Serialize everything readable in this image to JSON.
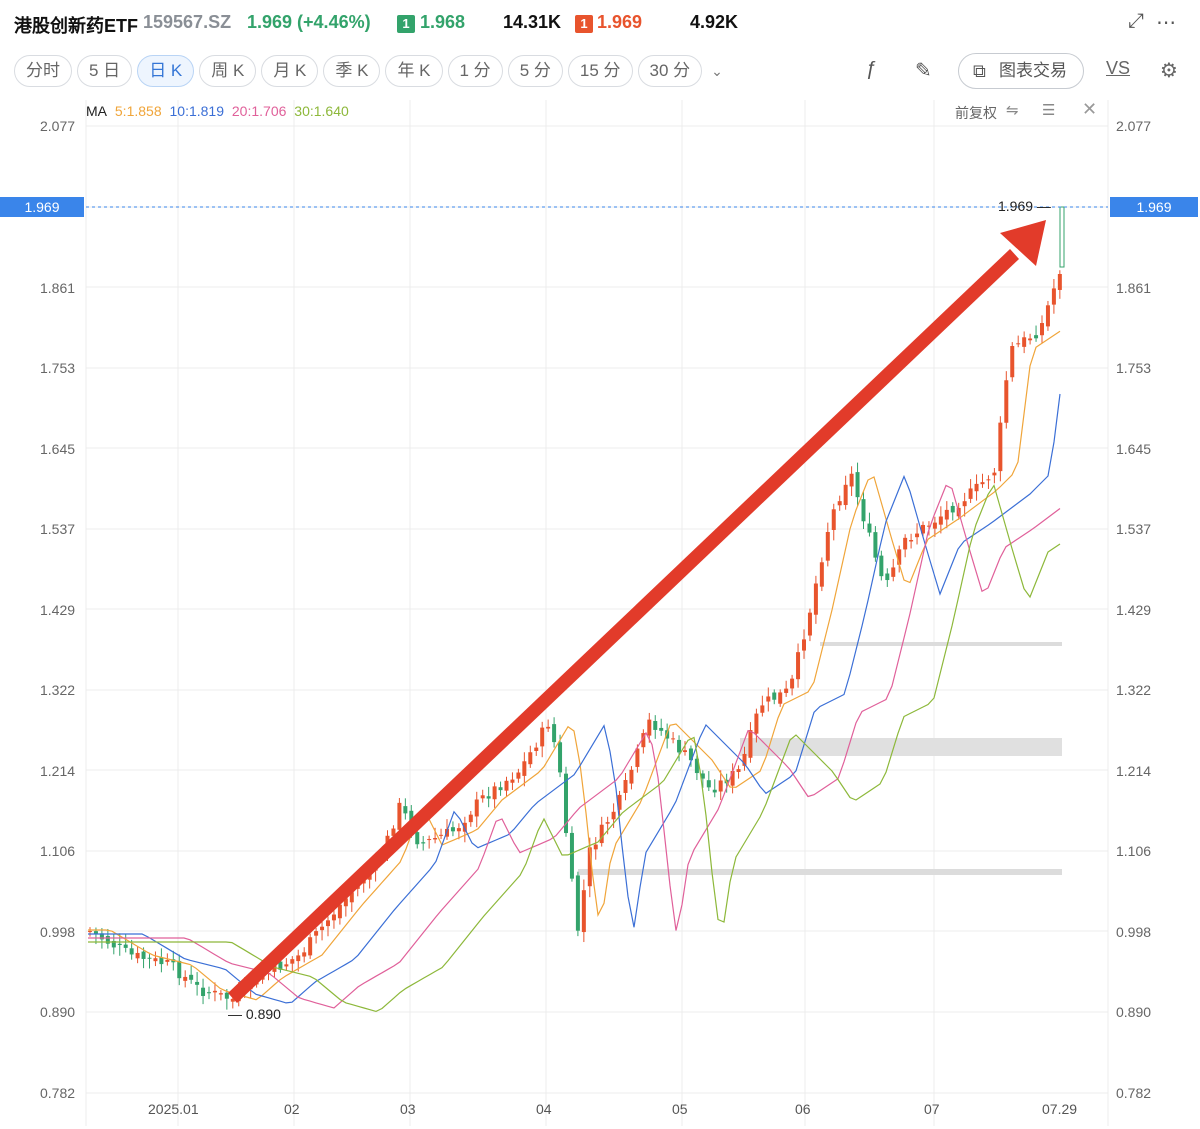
{
  "quote": {
    "name": "港股创新药ETF",
    "code": "159567.SZ",
    "price_change": "1.969 (+4.46%)",
    "bid_badge": "1",
    "bid_price": "1.968",
    "bid_volume": "14.31K",
    "ask_badge": "1",
    "ask_price": "1.969",
    "ask_volume": "4.92K",
    "icons": [
      "fullscreen-icon",
      "more-icon"
    ]
  },
  "tabs": [
    {
      "label": "分时",
      "active": false
    },
    {
      "label": "5 日",
      "active": false
    },
    {
      "label": "日 K",
      "active": true
    },
    {
      "label": "周 K",
      "active": false
    },
    {
      "label": "月 K",
      "active": false
    },
    {
      "label": "季 K",
      "active": false
    },
    {
      "label": "年 K",
      "active": false
    },
    {
      "label": "1 分",
      "active": false
    },
    {
      "label": "5 分",
      "active": false
    },
    {
      "label": "15 分",
      "active": false
    },
    {
      "label": "30 分",
      "active": false
    }
  ],
  "toolbar": {
    "trade_label": "图表交易",
    "vs_label": "VS",
    "icons": [
      "formula-icon",
      "pen-icon",
      "chart-trade-icon",
      "settings-icon"
    ]
  },
  "ma_legend": {
    "prefix": "MA",
    "items": [
      {
        "label": "5:1.858",
        "color": "#f0a53a"
      },
      {
        "label": "10:1.819",
        "color": "#3b6fd6"
      },
      {
        "label": "20:1.706",
        "color": "#e0609a"
      },
      {
        "label": "30:1.640",
        "color": "#8db83a"
      }
    ]
  },
  "adjust_label": "前复权",
  "colors": {
    "up": "#e8542d",
    "down": "#33a36b",
    "current": "#3a85ea",
    "arrow": "#e23b2a"
  },
  "y_axis": [
    "2.077",
    "1.969",
    "1.861",
    "1.753",
    "1.645",
    "1.537",
    "1.429",
    "1.322",
    "1.214",
    "1.106",
    "0.998",
    "0.890",
    "0.782"
  ],
  "current_price_tag": "1.969",
  "high_label": "1.969",
  "low_label": "0.890",
  "x_axis": [
    "2025.01",
    "02",
    "03",
    "04",
    "05",
    "06",
    "07",
    "07.29"
  ]
}
